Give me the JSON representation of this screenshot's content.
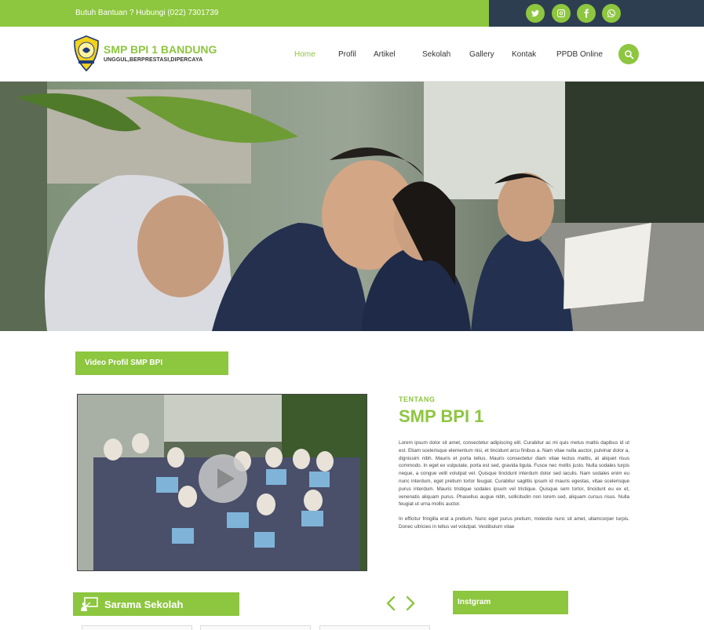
{
  "topbar": {
    "help_text": "Butuh Bantuan ? Hubungi (022) 7301739",
    "social_icons": [
      "twitter-icon",
      "instagram-icon",
      "facebook-icon",
      "whatsapp-icon"
    ],
    "colors": {
      "left": "#8dc63f",
      "right": "#2d3e50"
    }
  },
  "brand": {
    "name": "SMP BPI 1 BANDUNG",
    "tagline": "UNGGUL,BERPRESTASI,DIPERCAYA",
    "accent": "#8dc63f"
  },
  "nav": {
    "items": [
      {
        "label": "Home",
        "active": true
      },
      {
        "label": "Profil"
      },
      {
        "label": "Artikel"
      },
      {
        "label": "Sekolah"
      },
      {
        "label": "Gallery"
      },
      {
        "label": "Kontak"
      },
      {
        "label": "PPDB Online"
      }
    ],
    "search_icon": "search-icon"
  },
  "video_section": {
    "heading": "Video Profil SMP BPI"
  },
  "about": {
    "kicker": "TENTANG",
    "title": "SMP BPI 1",
    "paragraph1": "Lorem ipsum dolor sit amet, consectetur adipiscing elit. Curabitur ac mi quis metus mattis dapibus id ut est. Etiam scelerisque elementum nisi, et tincidunt arcu finibus a. Nam vitae nulla auctor, pulvinar dolor a, dignissim nibh. Mauris et porta tellus. Mauris consectetur diam vitae lectus mattis, at aliquet risus commodo. In eget ex vulputate, porta est sed, gravida ligula. Fusce nec mollis justo. Nulla sodales turpis neque, a congue velit volutpat vel. Quisque tincidunt interdum dolor sed iaculis. Nam sodales enim eu nunc interdum, eget pretium tortor feugiat. Curabitur sagittis ipsum id mauris egestas, vitae scelerisque purus interdum. Mauris tristique sodales ipsum vel tristique. Quisque sem tortor, tincidunt eu ex et, venenatis aliquam purus. Phasellus augue nibh, sollicitudin non lorem sed, aliquam cursus risus. Nulla feugiat ut urna mollis auctor.",
    "paragraph2": "In efficitur fringilla erat a pretium. Nunc eget purus pretium, molestie nunc sit amet, ullamcorper turpis. Donec ultricies in tellus vel volutpat. Vestibulum vitae"
  },
  "sarana": {
    "heading": "Sarama Sekolah"
  },
  "instagram": {
    "heading": "Instgram"
  }
}
